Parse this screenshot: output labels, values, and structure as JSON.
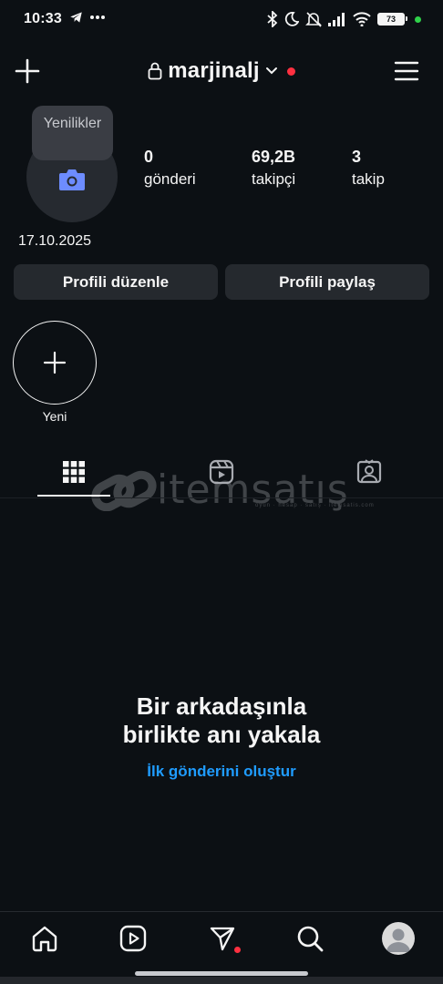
{
  "status_bar": {
    "time": "10:33",
    "battery": "73",
    "icons": [
      "telegram-icon",
      "more-dots-icon",
      "bluetooth-icon",
      "moon-icon",
      "mute-icon",
      "signal-icon",
      "wifi-icon",
      "battery-icon"
    ]
  },
  "header": {
    "username": "marjinalj",
    "icons": [
      "plus-icon",
      "lock-icon",
      "chevron-down-icon",
      "menu-icon"
    ]
  },
  "profile": {
    "note": "Yenilikler",
    "date": "17.10.2025",
    "stats": [
      {
        "value": "0",
        "label": "gönderi"
      },
      {
        "value": "69,2B",
        "label": "takipçi"
      },
      {
        "value": "3",
        "label": "takip"
      }
    ]
  },
  "buttons": {
    "edit_profile": "Profili düzenle",
    "share_profile": "Profili paylaş"
  },
  "highlights": {
    "new_label": "Yeni"
  },
  "tabs": [
    "grid-icon",
    "reels-icon",
    "tagged-icon"
  ],
  "watermark": {
    "text": "itemsatış",
    "sub": "oyun · hesap · satış · itemsatis.com"
  },
  "empty_state": {
    "title_line1": "Bir arkadaşınla",
    "title_line2": "birlikte anı yakala",
    "link": "İlk gönderini oluştur"
  },
  "bottom_nav": [
    "home-icon",
    "reels-icon",
    "direct-icon",
    "search-icon",
    "profile-avatar"
  ],
  "colors": {
    "background": "#0c1014",
    "button": "#25292e",
    "link": "#1f9cff",
    "notification": "#ff3040",
    "camera_icon": "#6d8cff"
  }
}
